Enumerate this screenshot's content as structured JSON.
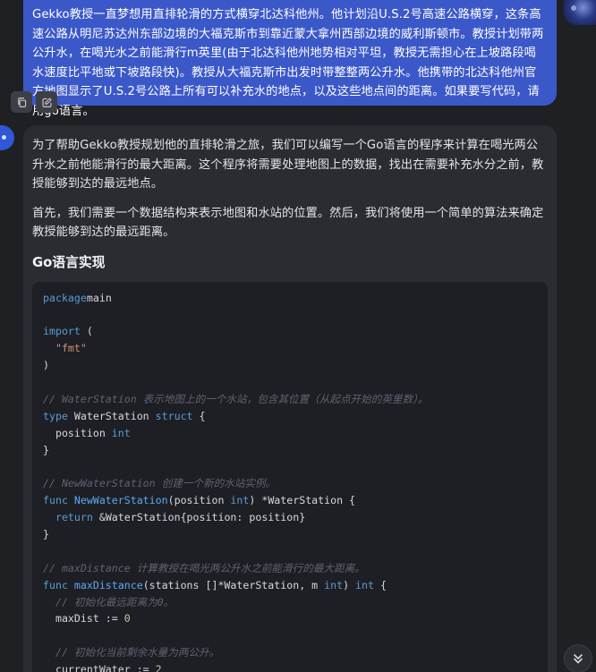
{
  "user_message": {
    "text": "Gekko教授一直梦想用直排轮滑的方式横穿北达科他州。他计划沿U.S.2号高速公路横穿，这条高速公路从明尼苏达州东部边境的大福克斯市到靠近蒙大拿州西部边境的威利斯顿市。教授计划带两公升水，在喝光水之前能滑行m英里(由于北达科他州地势相对平坦，教授无需担心在上坡路段喝水速度比平地或下坡路段快)。教授从大福克斯市出发时带整整两公升水。他携带的北达科他州官方地图显示了U.S.2号公路上所有可以补充水的地点，以及这些地点间的距离。如果要写代码，请用go语言。",
    "actions": [
      "copy-icon",
      "edit-icon"
    ]
  },
  "ai_message": {
    "para1": "为了帮助Gekko教授规划他的直排轮滑之旅，我们可以编写一个Go语言的程序来计算在喝光两公升水之前他能滑行的最大距离。这个程序将需要处理地图上的数据，找出在需要补充水分之前，教授能够到达的最远地点。",
    "para2": "首先，我们需要一个数据结构来表示地图和水站的位置。然后，我们将使用一个简单的算法来确定教授能够到达的最远距离。",
    "heading": "Go语言实现",
    "code": [
      [
        [
          "kw",
          "package"
        ],
        [
          "",
          "main"
        ]
      ],
      [],
      [
        [
          "kw",
          "import"
        ],
        [
          "",
          " ("
        ]
      ],
      [
        [
          "",
          "  "
        ],
        [
          "str",
          "\"fmt\""
        ]
      ],
      [
        [
          "",
          ")"
        ]
      ],
      [],
      [
        [
          "cm",
          "// WaterStation 表示地图上的一个水站，包含其位置（从起点开始的英里数）。"
        ]
      ],
      [
        [
          "kw",
          "type"
        ],
        [
          "",
          " WaterStation "
        ],
        [
          "kw",
          "struct"
        ],
        [
          "",
          " {"
        ]
      ],
      [
        [
          "",
          "  position "
        ],
        [
          "kw",
          "int"
        ]
      ],
      [
        [
          "",
          "}"
        ]
      ],
      [],
      [
        [
          "cm",
          "// NewWaterStation 创建一个新的水站实例。"
        ]
      ],
      [
        [
          "kw",
          "func"
        ],
        [
          "",
          " "
        ],
        [
          "fn",
          "NewWaterStation"
        ],
        [
          "",
          "(position "
        ],
        [
          "kw",
          "int"
        ],
        [
          "",
          ") *WaterStation {"
        ]
      ],
      [
        [
          "",
          "  "
        ],
        [
          "kw",
          "return"
        ],
        [
          "",
          " &WaterStation{position: position}"
        ]
      ],
      [
        [
          "",
          "}"
        ]
      ],
      [],
      [
        [
          "cm",
          "// maxDistance 计算教授在喝光两公升水之前能滑行的最大距离。"
        ]
      ],
      [
        [
          "kw",
          "func"
        ],
        [
          "",
          " "
        ],
        [
          "fn",
          "maxDistance"
        ],
        [
          "",
          "(stations []*WaterStation, m "
        ],
        [
          "kw",
          "int"
        ],
        [
          "",
          ") "
        ],
        [
          "kw",
          "int"
        ],
        [
          "",
          " {"
        ]
      ],
      [
        [
          "",
          "  "
        ],
        [
          "cm",
          "// 初始化最远距离为0。"
        ]
      ],
      [
        [
          "",
          "  maxDist := "
        ],
        [
          "num",
          "0"
        ]
      ],
      [],
      [
        [
          "",
          "  "
        ],
        [
          "cm",
          "// 初始化当前剩余水量为两公升。"
        ]
      ],
      [
        [
          "",
          "  currentWater := "
        ],
        [
          "num",
          "2"
        ]
      ]
    ]
  }
}
